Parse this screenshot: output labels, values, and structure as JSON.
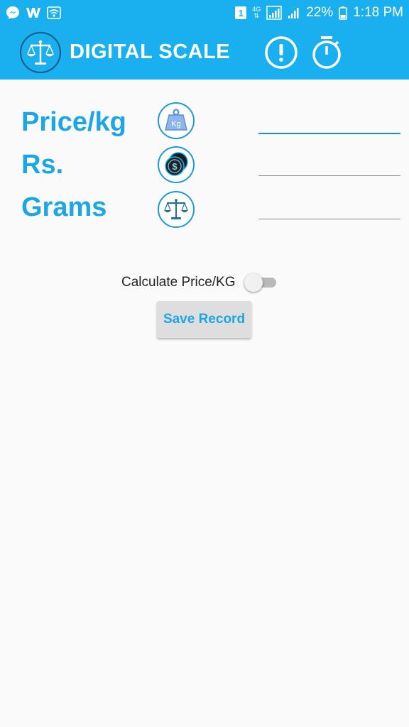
{
  "status_bar": {
    "left_icons": [
      "messenger-icon",
      "w-app-icon",
      "wifi-icon"
    ],
    "sim_badge": "1",
    "network": "4G",
    "battery_percent": "22%",
    "time": "1:18 PM"
  },
  "app_bar": {
    "title": "DIGITAL SCALE",
    "actions": [
      "info-icon",
      "timer-icon"
    ]
  },
  "form": {
    "rows": [
      {
        "label": "Price/kg",
        "icon": "kg-weight-icon",
        "value": "",
        "focused": true
      },
      {
        "label": "Rs.",
        "icon": "coins-icon",
        "value": ""
      },
      {
        "label": "Grams",
        "icon": "balance-scale-icon",
        "value": ""
      }
    ]
  },
  "calculate_toggle": {
    "label": "Calculate Price/KG",
    "checked": false
  },
  "save_button": {
    "label": "Save Record"
  },
  "colors": {
    "primary": "#1ab0ef",
    "label_blue": "#1ea6e4",
    "background": "#fafafa",
    "button_bg": "#dedede"
  }
}
